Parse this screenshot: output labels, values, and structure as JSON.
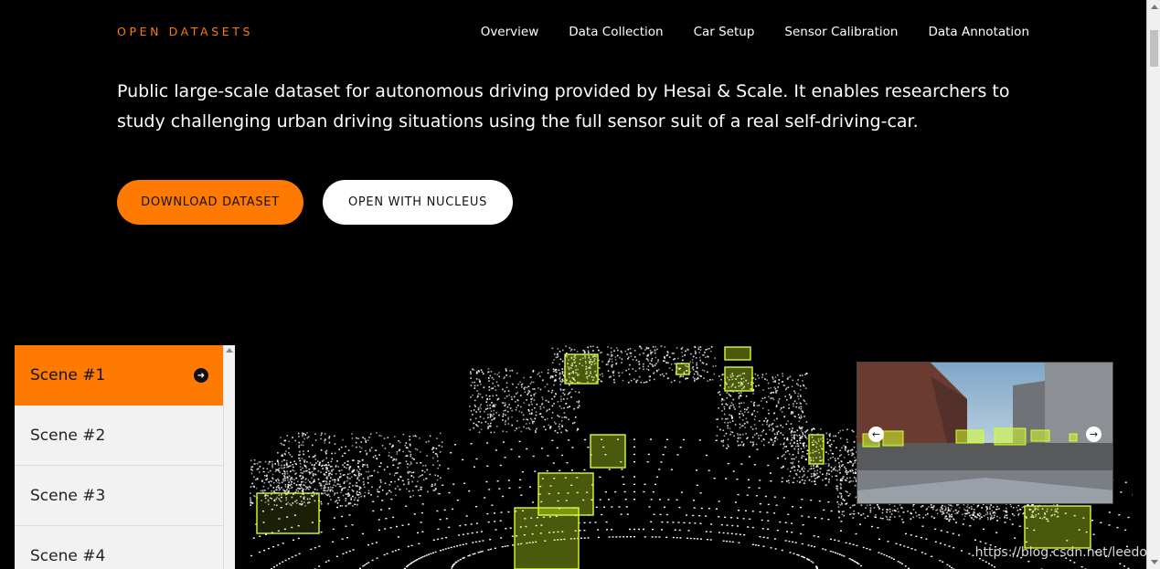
{
  "nav": {
    "brand": "OPEN DATASETS",
    "links": [
      "Overview",
      "Data Collection",
      "Car Setup",
      "Sensor Calibration",
      "Data Annotation"
    ]
  },
  "hero": {
    "text": "Public large-scale dataset for autonomous driving provided by Hesai & Scale. It enables researchers to study challenging urban driving situations using the full sensor suit of a real self-driving-car.",
    "download_label": "DOWNLOAD DATASET",
    "nucleus_label": "OPEN WITH NUCLEUS"
  },
  "scenes": [
    "Scene #1",
    "Scene #2",
    "Scene #3",
    "Scene #4"
  ],
  "colors": {
    "accent": "#ff7a00",
    "box": "#d7ff2a"
  },
  "watermark": "https://blog.csdn.net/leedo"
}
